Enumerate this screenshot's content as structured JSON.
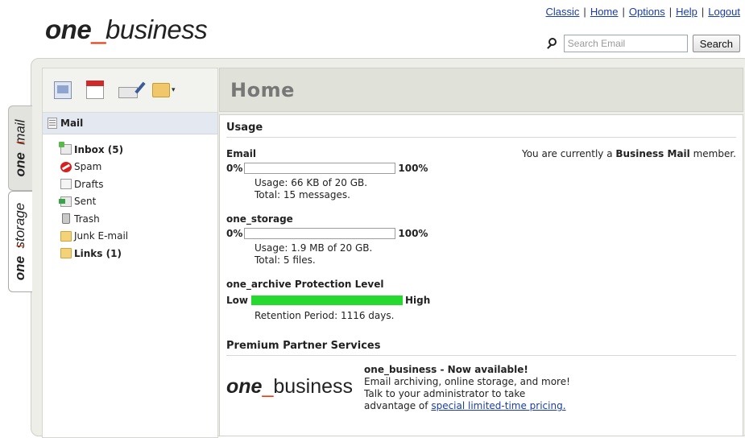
{
  "header": {
    "logo": {
      "bold": "one",
      "underscore": "_",
      "light": "business"
    },
    "links": [
      "Classic",
      "Home",
      "Options",
      "Help",
      "Logout"
    ],
    "separator": "|",
    "search": {
      "placeholder": "Search Email",
      "value": "",
      "button_label": "Search"
    }
  },
  "side_tabs": [
    {
      "bold": "one",
      "underscore": "_",
      "light": "mail"
    },
    {
      "bold": "one",
      "underscore": "_",
      "light": "storage"
    }
  ],
  "toolbar": {
    "icons": [
      "contacts-icon",
      "calendar-icon",
      "compose-icon",
      "folder-menu-icon"
    ]
  },
  "mail_section": {
    "title": "Mail",
    "folders": [
      {
        "label": "Inbox (5)",
        "icon": "inbox-icon",
        "bold": true
      },
      {
        "label": "Spam",
        "icon": "spam-icon",
        "bold": false
      },
      {
        "label": "Drafts",
        "icon": "drafts-icon",
        "bold": false
      },
      {
        "label": "Sent",
        "icon": "sent-icon",
        "bold": false
      },
      {
        "label": "Trash",
        "icon": "trash-icon",
        "bold": false
      },
      {
        "label": "Junk E-mail",
        "icon": "folder-icon",
        "bold": false
      },
      {
        "label": "Links (1)",
        "icon": "folder-icon",
        "bold": true
      }
    ]
  },
  "main": {
    "title": "Home",
    "usage_title": "Usage",
    "member_prefix": "You are currently a ",
    "member_level": "Business Mail",
    "member_suffix": " member.",
    "email": {
      "label": "Email",
      "min": "0%",
      "max": "100%",
      "fill_fraction": 0,
      "usage": "Usage: 66 KB of 20 GB.",
      "total": "Total: 15 messages."
    },
    "storage": {
      "label": "one_storage",
      "min": "0%",
      "max": "100%",
      "fill_fraction": 0,
      "usage": "Usage: 1.9 MB of 20 GB.",
      "total": "Total: 5 files."
    },
    "archive": {
      "label": "one_archive Protection Level",
      "low": "Low",
      "high": "High",
      "fill_fraction": 1.0,
      "bar_color": "#25d92e",
      "retention": "Retention Period: 1116 days."
    },
    "premium": {
      "title": "Premium Partner Services",
      "logo": {
        "bold": "one",
        "underscore": "_",
        "light": "business"
      },
      "headline": "one_business - Now available!",
      "line1": "Email archiving, online storage, and more!",
      "line2": "Talk to your administrator to take",
      "line3_prefix": "advantage of ",
      "line3_link": "special limited-time pricing."
    }
  },
  "colors": {
    "brand_accent": "#e8380d",
    "link": "#1a3da8",
    "progress": "#25d92e"
  }
}
